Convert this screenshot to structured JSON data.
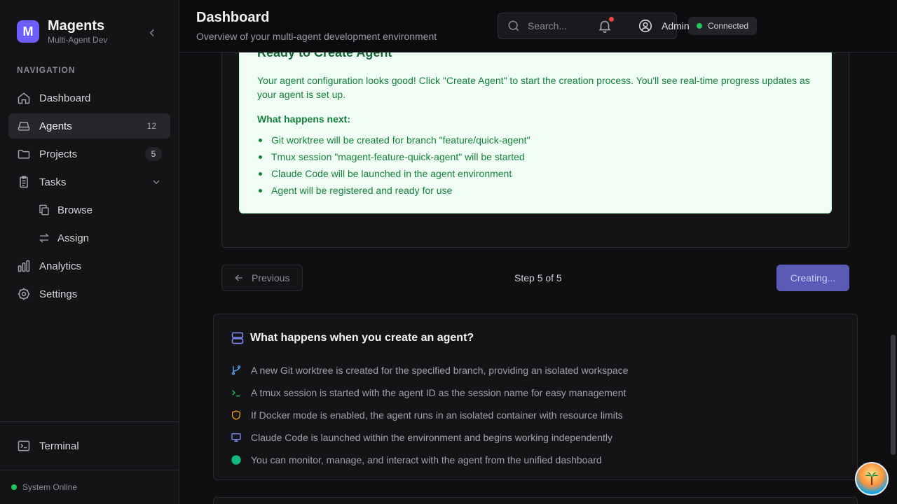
{
  "brand": {
    "logo_letter": "M",
    "name": "Magents",
    "subtitle": "Multi-Agent Dev"
  },
  "sidebar": {
    "section_label": "NAVIGATION",
    "items": [
      {
        "label": "Dashboard",
        "icon": "home-icon"
      },
      {
        "label": "Agents",
        "icon": "hard-drive-icon",
        "badge": "12",
        "active": true
      },
      {
        "label": "Projects",
        "icon": "folder-icon",
        "badge": "5"
      },
      {
        "label": "Tasks",
        "icon": "clipboard-icon",
        "expanded": true
      },
      {
        "label": "Browse",
        "icon": "copy-icon",
        "sub": true
      },
      {
        "label": "Assign",
        "icon": "arrows-swap-icon",
        "sub": true
      },
      {
        "label": "Analytics",
        "icon": "bar-chart-icon"
      },
      {
        "label": "Settings",
        "icon": "gear-icon"
      }
    ],
    "terminal_label": "Terminal",
    "system_status": "System Online"
  },
  "header": {
    "title": "Dashboard",
    "subtitle": "Overview of your multi-agent development environment",
    "search_placeholder": "Search...",
    "connection": "Connected",
    "user": "Admin"
  },
  "ready": {
    "title": "Ready to Create Agent",
    "body": "Your agent configuration looks good! Click \"Create Agent\" to start the creation process. You'll see real-time progress updates as your agent is set up.",
    "next_heading": "What happens next:",
    "steps": [
      "Git worktree will be created for branch \"feature/quick-agent\"",
      "Tmux session \"magent-feature-quick-agent\" will be started",
      "Claude Code will be launched in the agent environment",
      "Agent will be registered and ready for use"
    ]
  },
  "wizard": {
    "previous_label": "Previous",
    "step_text": "Step 5 of 5",
    "create_label": "Creating..."
  },
  "info": {
    "title": "What happens when you create an agent?",
    "items": [
      {
        "icon": "git-branch-icon",
        "color": "#60a5fa",
        "text": "A new Git worktree is created for the specified branch, providing an isolated workspace"
      },
      {
        "icon": "terminal-prompt-icon",
        "color": "#22c55e",
        "text": "A tmux session is started with the agent ID as the session name for easy management"
      },
      {
        "icon": "shield-icon",
        "color": "#f59e0b",
        "text": "If Docker mode is enabled, the agent runs in an isolated container with resource limits"
      },
      {
        "icon": "monitor-icon",
        "color": "#818cf8",
        "text": "Claude Code is launched within the environment and begins working independently"
      },
      {
        "icon": "status-dot-icon",
        "color": "#10b981",
        "text": "You can monitor, manage, and interact with the agent from the unified dashboard"
      }
    ]
  }
}
